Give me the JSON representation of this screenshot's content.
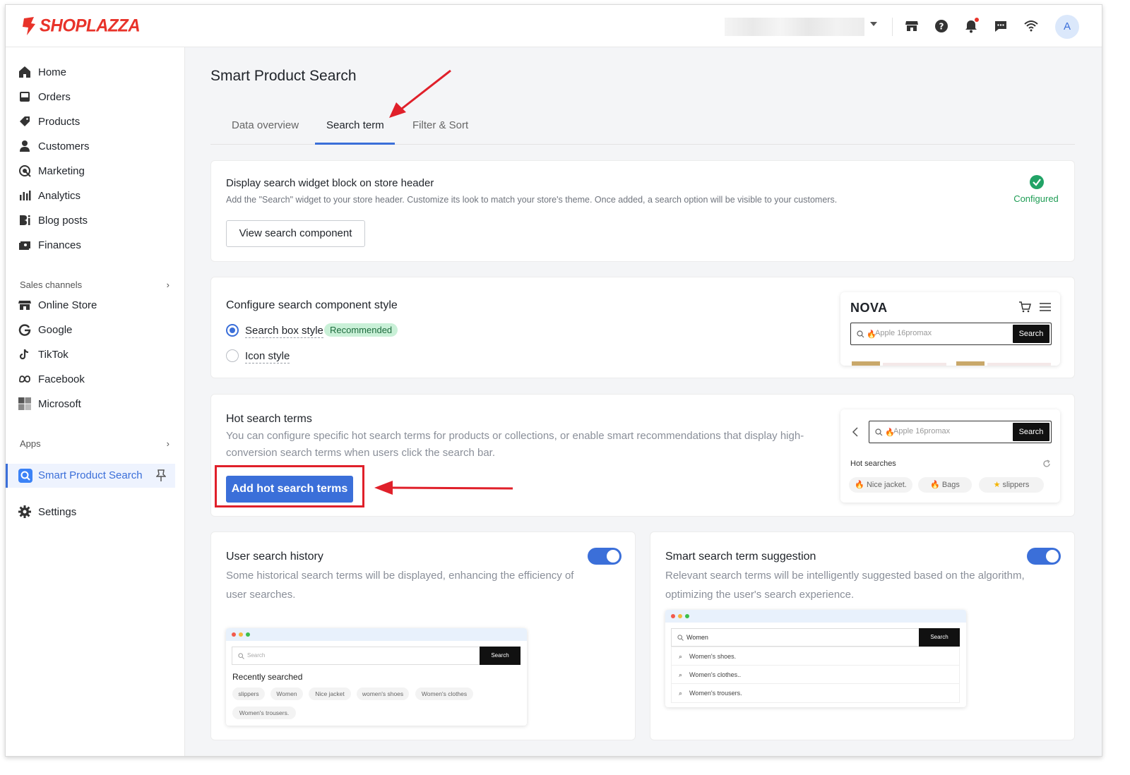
{
  "app": {
    "logo_text": "SHOPLAZZA",
    "avatar_initial": "A"
  },
  "sidebar": {
    "items": [
      {
        "label": "Home",
        "icon": "home-icon"
      },
      {
        "label": "Orders",
        "icon": "inbox-icon"
      },
      {
        "label": "Products",
        "icon": "tag-icon"
      },
      {
        "label": "Customers",
        "icon": "person-icon"
      },
      {
        "label": "Marketing",
        "icon": "target-icon"
      },
      {
        "label": "Analytics",
        "icon": "bar-chart-icon"
      },
      {
        "label": "Blog posts",
        "icon": "blog-icon"
      },
      {
        "label": "Finances",
        "icon": "finance-icon"
      }
    ],
    "sales_channels_label": "Sales channels",
    "channels": [
      {
        "label": "Online Store",
        "icon": "store-icon"
      },
      {
        "label": "Google",
        "icon": "google-icon"
      },
      {
        "label": "TikTok",
        "icon": "tiktok-icon"
      },
      {
        "label": "Facebook",
        "icon": "meta-icon"
      },
      {
        "label": "Microsoft",
        "icon": "microsoft-icon"
      }
    ],
    "apps_label": "Apps",
    "active_app": "Smart Product Search",
    "settings_label": "Settings"
  },
  "page": {
    "title": "Smart Product Search",
    "tabs": [
      {
        "label": "Data overview"
      },
      {
        "label": "Search term"
      },
      {
        "label": "Filter & Sort"
      }
    ],
    "active_tab": "Search term"
  },
  "widget_card": {
    "title": "Display search widget block on store header",
    "desc": "Add the \"Search\" widget to your store header. Customize its look to match your store's theme. Once added, a search option will be visible to your customers.",
    "button": "View search component",
    "status": "Configured"
  },
  "style_card": {
    "title": "Configure search component style",
    "option1": "Search box style",
    "badge": "Recommended",
    "option2": "Icon style",
    "preview_brand": "NOVA",
    "preview_placeholder": "Apple 16promax",
    "preview_button": "Search"
  },
  "hot_card": {
    "title": "Hot search terms",
    "desc": "You can configure specific hot search terms for products or collections, or enable smart recommendations that display high-conversion search terms when users click the search bar.",
    "button": "Add hot search terms",
    "preview_placeholder": "Apple 16promax",
    "preview_button": "Search",
    "preview_heading": "Hot searches",
    "preview_chips": [
      "Nice jacket.",
      "Bags",
      "slippers"
    ]
  },
  "history_card": {
    "title": "User search history",
    "desc": "Some historical search terms will be displayed, enhancing the efficiency of user searches.",
    "toggle_on": true,
    "preview_placeholder": "Search",
    "preview_button": "Search",
    "preview_heading": "Recently searched",
    "preview_chips": [
      "slippers",
      "Women",
      "Nice jacket",
      "women's shoes",
      "Women's  clothes",
      "Women's  trousers."
    ]
  },
  "suggest_card": {
    "title": "Smart search term suggestion",
    "desc": "Relevant search terms will be intelligently suggested based on the algorithm, optimizing the user's search experience.",
    "toggle_on": true,
    "preview_query": "Women",
    "preview_button": "Search",
    "preview_rows": [
      "Women's shoes.",
      "Women's  clothes..",
      "Women's  trousers."
    ]
  },
  "colors": {
    "accent": "#3b6fd9",
    "brand": "#e8332a",
    "success": "#21a366",
    "annotation": "#e0202a"
  }
}
